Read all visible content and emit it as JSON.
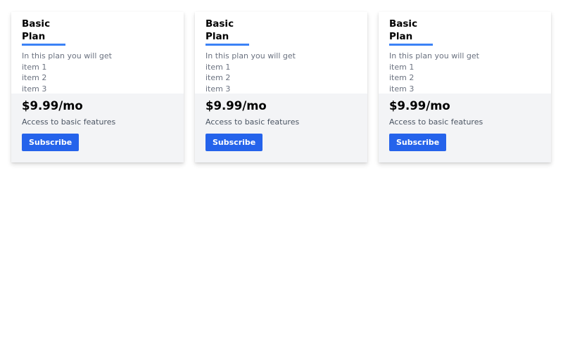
{
  "plans": [
    {
      "title": "Basic Plan",
      "intro": "In this plan you will get",
      "items": [
        "item 1",
        "item 2",
        "item 3"
      ],
      "price": "$9.99/mo",
      "description": "Access to basic features",
      "button_label": "Subscribe"
    },
    {
      "title": "Basic Plan",
      "intro": "In this plan you will get",
      "items": [
        "item 1",
        "item 2",
        "item 3"
      ],
      "price": "$9.99/mo",
      "description": "Access to basic features",
      "button_label": "Subscribe"
    },
    {
      "title": "Basic Plan",
      "intro": "In this plan you will get",
      "items": [
        "item 1",
        "item 2",
        "item 3"
      ],
      "price": "$9.99/mo",
      "description": "Access to basic features",
      "button_label": "Subscribe"
    }
  ],
  "colors": {
    "accent": "#2563eb",
    "title_underline": "#3b82f6",
    "card_footer_bg": "#f3f4f6",
    "muted_text": "#6b7280"
  }
}
